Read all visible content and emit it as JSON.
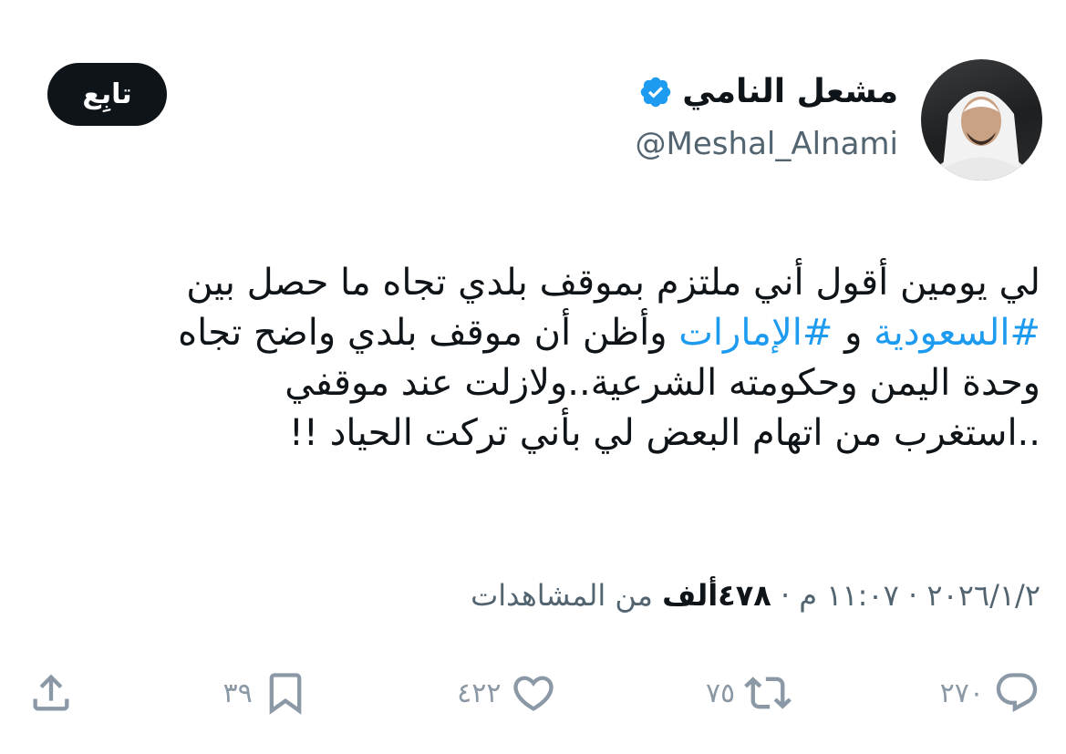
{
  "author": {
    "display_name": "مشعل النامي",
    "handle": "@Meshal_Alnami",
    "verified": true,
    "avatar": "profile-photo"
  },
  "follow_button": {
    "label": "تابِع"
  },
  "tweet": {
    "lines": [
      [
        {
          "text": "لي يومين أقول أني ملتزم بموقف بلدي تجاه ما حصل بين",
          "type": "text"
        }
      ],
      [
        {
          "text": "#السعودية",
          "type": "hashtag"
        },
        {
          "text": " و ",
          "type": "text"
        },
        {
          "text": "#الإمارات",
          "type": "hashtag"
        },
        {
          "text": " وأظن أن موقف بلدي واضح تجاه",
          "type": "text"
        }
      ],
      [
        {
          "text": "وحدة اليمن وحكومته الشرعية..ولازلت عند موقفي",
          "type": "text"
        }
      ],
      [
        {
          "text": "..استغرب من اتهام البعض لي بأني تركت الحياد !!",
          "type": "text"
        }
      ]
    ]
  },
  "meta": {
    "date": "٢٠٢٦/١/٢",
    "separator": " · ",
    "time": "١١:٠٧ م",
    "views_count": "٤٧٨ألف",
    "views_label": " من المشاهدات"
  },
  "actions": {
    "share": {
      "icon": "share-icon"
    },
    "bookmarks": {
      "count": "٣٩",
      "icon": "bookmark-icon"
    },
    "likes": {
      "count": "٤٢٢",
      "icon": "heart-icon"
    },
    "reposts": {
      "count": "٧٥",
      "icon": "repost-icon"
    },
    "replies": {
      "count": "٢٧٠",
      "icon": "reply-icon"
    }
  },
  "colors": {
    "hashtag": "#1d9bf0",
    "verified": "#1d9bf0",
    "text": "#0f1419",
    "secondary": "#536471",
    "icon": "#8b98a5"
  }
}
